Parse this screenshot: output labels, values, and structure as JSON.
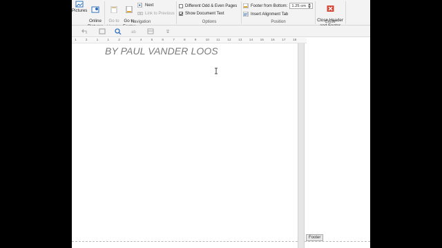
{
  "ribbon": {
    "insert": {
      "pictures_label": "Pictures",
      "online_pictures_label": "Online\nPictures"
    },
    "navigation": {
      "go_to_header_label": "Go to\nHeader",
      "go_to_footer_label": "Go to\nFooter",
      "next_label": "Next",
      "link_to_previous_label": "Link to Previous",
      "group_label": "Navigation"
    },
    "options": {
      "different_odd_even_label": "Different Odd & Even Pages",
      "show_document_text_label": "Show Document Text",
      "different_odd_even_checked": false,
      "show_document_text_checked": true,
      "group_label": "Options"
    },
    "position": {
      "footer_from_bottom_label": "Footer from Bottom:",
      "footer_from_bottom_value": "1.25 cm",
      "insert_alignment_tab_label": "Insert Alignment Tab",
      "group_label": "Position"
    },
    "close": {
      "close_label": "Close Header\nand Footer",
      "group_label": "Close"
    }
  },
  "ruler": {
    "ticks": [
      "1",
      "2",
      "1",
      "1",
      "2",
      "3",
      "4",
      "5",
      "6",
      "7",
      "8",
      "9",
      "10",
      "11",
      "12",
      "13",
      "14",
      "15",
      "16",
      "17",
      "18"
    ]
  },
  "document": {
    "text": "BY PAUL VANDER LOOS"
  },
  "footer_tag": "Footer",
  "colors": {
    "close_red": "#d64533",
    "icon_blue": "#2b6cb8",
    "icon_gold": "#e0a52f"
  }
}
